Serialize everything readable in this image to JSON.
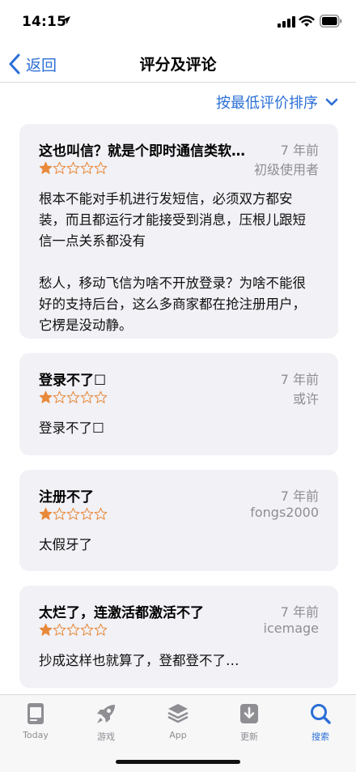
{
  "status_bar": {
    "time": "14:15"
  },
  "nav": {
    "back_label": "返回",
    "title": "评分及评论"
  },
  "sort": {
    "label": "按最低评价排序"
  },
  "colors": {
    "accent": "#2b6fd6",
    "star": "#e8893a",
    "card_bg": "#f1f1f6",
    "muted": "#8e8e93"
  },
  "reviews": [
    {
      "title": "这也叫信？就是个即时通信类软…",
      "date": "7 年前",
      "author": "初级使用者",
      "rating": 1,
      "body": [
        "根本不能对手机进行发短信，必须双方都安装，而且都运行才能接受到消息，压根儿跟短信一点关系都没有",
        "愁人，移动飞信为啥不开放登录？为啥不能很好的支持后台，这么多商家都在抢注册用户，它楞是没动静。"
      ]
    },
    {
      "title": "登录不了☐",
      "date": "7 年前",
      "author": "或许",
      "rating": 1,
      "body": [
        "登录不了☐"
      ]
    },
    {
      "title": "注册不了",
      "date": "7 年前",
      "author": "fongs2000",
      "rating": 1,
      "body": [
        "太假牙了"
      ]
    },
    {
      "title": "太烂了，连激活都激活不了",
      "date": "7 年前",
      "author": "icemage",
      "rating": 1,
      "body": [
        "抄成这样也就算了，登都登不了…"
      ]
    }
  ],
  "tabs": [
    {
      "label": "Today",
      "icon": "today-icon"
    },
    {
      "label": "游戏",
      "icon": "rocket-icon"
    },
    {
      "label": "App",
      "icon": "layers-icon"
    },
    {
      "label": "更新",
      "icon": "download-icon"
    },
    {
      "label": "搜索",
      "icon": "search-icon",
      "active": true
    }
  ]
}
